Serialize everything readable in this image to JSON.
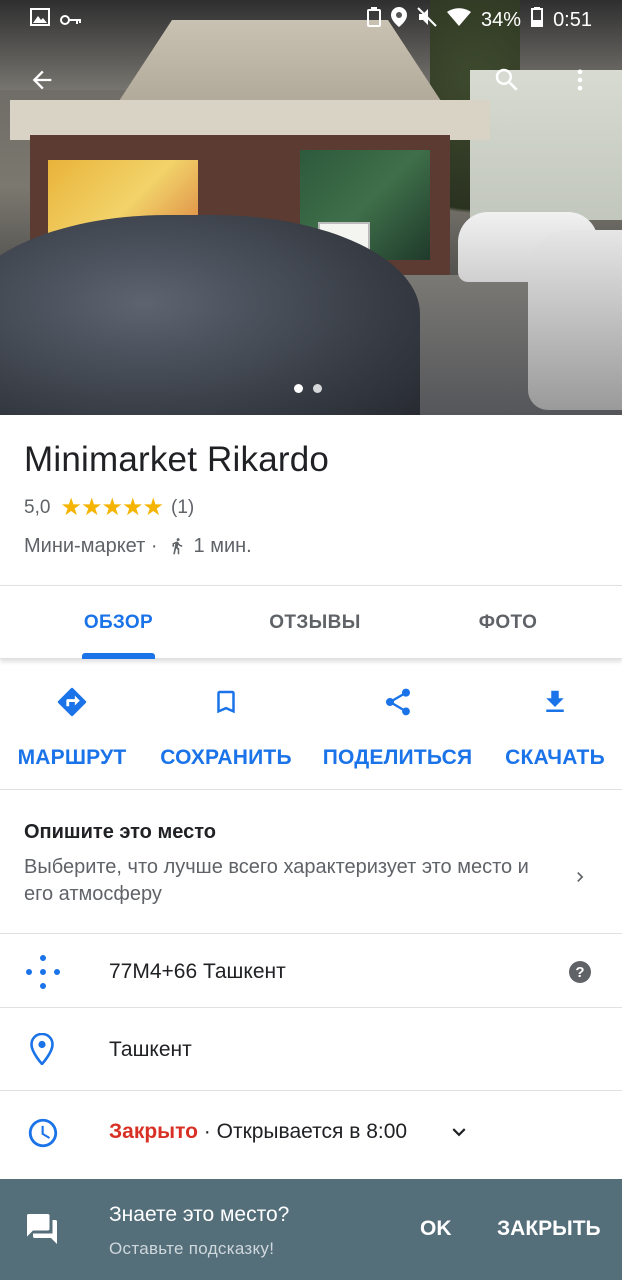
{
  "status_bar": {
    "time": "0:51",
    "battery": "34%",
    "icons": [
      "image-icon",
      "key-icon",
      "sync-icon",
      "location-icon",
      "mute-icon",
      "wifi-icon",
      "battery-icon"
    ]
  },
  "hero": {
    "photo_count": 2,
    "active_photo": 1
  },
  "place": {
    "name": "Minimarket Rikardo",
    "rating": "5,0",
    "stars": "★★★★★",
    "reviews_count": "(1)",
    "category": "Мини-маркет ·",
    "walk_time": "1 мин."
  },
  "tabs": [
    {
      "label": "ОБЗОР",
      "active": true
    },
    {
      "label": "ОТЗЫВЫ",
      "active": false
    },
    {
      "label": "ФОТО",
      "active": false
    }
  ],
  "actions": [
    {
      "label": "МАРШРУТ",
      "icon": "directions-icon"
    },
    {
      "label": "СОХРАНИТЬ",
      "icon": "bookmark-icon"
    },
    {
      "label": "ПОДЕЛИТЬСЯ",
      "icon": "share-icon"
    },
    {
      "label": "СКАЧАТЬ",
      "icon": "download-icon"
    }
  ],
  "describe": {
    "heading": "Опишите это место",
    "text": "Выберите, что лучше всего характеризует это место и его атмосферу"
  },
  "info": {
    "plus_code": "77M4+66 Ташкент",
    "address": "Ташкент",
    "hours_status": "Закрыто",
    "hours_detail": " · Открывается в 8:00"
  },
  "snackbar": {
    "title": "Знаете это место?",
    "subtitle": "Оставьте подсказку!",
    "ok_label": "OK",
    "close_label": "ЗАКРЫТЬ"
  },
  "colors": {
    "accent": "#1a73e8",
    "star": "#f4b400",
    "closed": "#d93025",
    "snackbar_bg": "#546e7a"
  }
}
